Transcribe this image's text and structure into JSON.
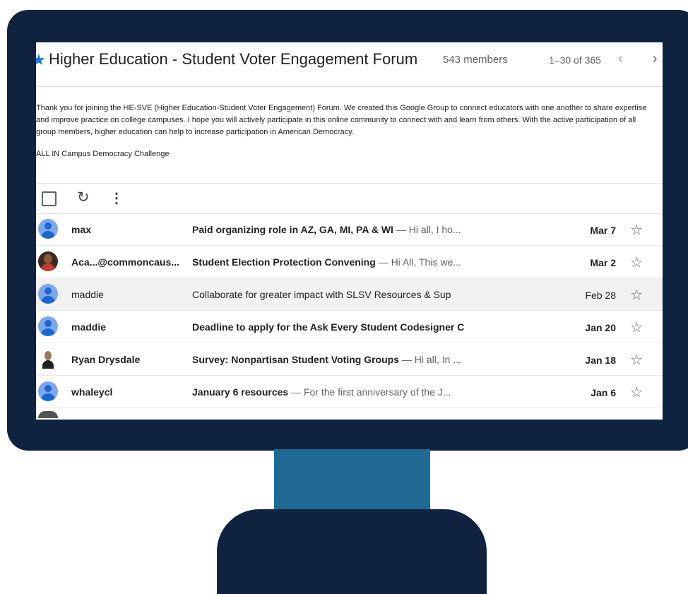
{
  "header": {
    "title": "Higher Education - Student Voter Engagement Forum",
    "members": "543 members",
    "pagination": "1–30 of 365",
    "prev_icon": "chevron-left-icon",
    "next_icon": "chevron-right-icon"
  },
  "about": {
    "description": "Thank you for joining the HE-SVE (Higher Education-Student Voter Engagement) Forum. We created this Google Group to connect educators with one another to share expertise and improve practice on college campuses. I hope you will actively participate in this online community to connect with and learn from others. With the active participation of all group members, higher education can help to increase participation in American Democracy.",
    "subtitle": "ALL IN Campus Democracy Challenge"
  },
  "toolbar": {
    "select_all_icon": "checkbox-icon",
    "refresh_icon": "refresh-icon",
    "more_icon": "more-vertical-icon"
  },
  "conversations": [
    {
      "sender": "max",
      "subject": "Paid organizing role in AZ, GA, MI, PA & WI",
      "snippet": " — Hi all, I ho...",
      "date": "Mar 7",
      "unread": true
    },
    {
      "sender": "Aca...@commoncaus...",
      "subject": "Student Election Protection Convening",
      "snippet": " — Hi All, This we...",
      "date": "Mar 2",
      "unread": true
    },
    {
      "sender": "maddie",
      "subject": "Collaborate for greater impact with SLSV Resources & Sup",
      "snippet": "",
      "date": "Feb 28",
      "unread": false
    },
    {
      "sender": "maddie",
      "subject": "Deadline to apply for the Ask Every Student Codesigner C",
      "snippet": "",
      "date": "Jan 20",
      "unread": true
    },
    {
      "sender": "Ryan Drysdale",
      "subject": "Survey: Nonpartisan Student Voting Groups",
      "snippet": " — Hi all, In ...",
      "date": "Jan 18",
      "unread": true
    },
    {
      "sender": "whaleycl",
      "subject": "January 6 resources",
      "snippet": " — For the first anniversary of the J...",
      "date": "Jan 6",
      "unread": true
    }
  ],
  "colors": {
    "frame": "#0f2340",
    "stand": "#1e6a93",
    "accent": "#1a73e8"
  }
}
